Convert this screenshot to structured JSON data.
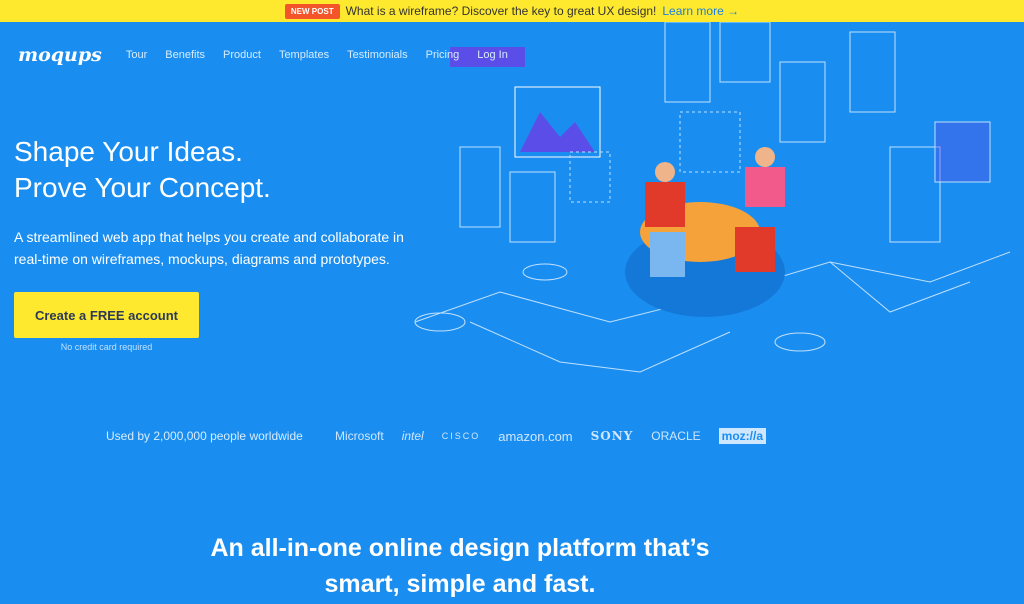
{
  "banner": {
    "badge": "NEW POST",
    "text": "What is a wireframe? Discover the key to great UX design!",
    "link": "Learn more →"
  },
  "nav": {
    "logo": "moqups",
    "items": [
      "Tour",
      "Benefits",
      "Product",
      "Templates",
      "Testimonials",
      "Pricing",
      "Log In"
    ]
  },
  "hero": {
    "title_line1": "Shape Your Ideas.",
    "title_line2": "Prove Your Concept.",
    "lead": "A streamlined web app that helps you create and collaborate in real-time on wireframes, mockups, diagrams and prototypes.",
    "cta": "Create a FREE account",
    "note": "No credit card required"
  },
  "clients": {
    "label": "Used by 2,000,000 people worldwide",
    "logos": [
      "Microsoft",
      "intel",
      "CISCO",
      "amazon.com",
      "SONY",
      "ORACLE",
      "moz://a"
    ]
  },
  "tagline": {
    "line1": "An all-in-one online design platform that’s",
    "line2": "smart, simple and fast."
  },
  "colors": {
    "background": "#1a8ef0",
    "banner": "#ffe92e",
    "badge": "#f4542a"
  }
}
